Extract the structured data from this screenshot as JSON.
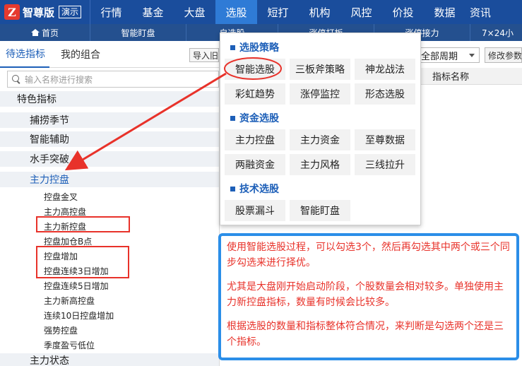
{
  "brand": {
    "logo_mark": "Z",
    "name": "智尊版",
    "demo": "演示"
  },
  "topnav": [
    "行情",
    "基金",
    "大盘",
    "选股",
    "短打",
    "机构",
    "风控",
    "价投",
    "数据",
    "资讯"
  ],
  "subnav": [
    "首页",
    "智能盯盘",
    "自选股",
    "涨停打板",
    "涨停接力",
    "7×24小"
  ],
  "tabs": {
    "pending": "待选指标",
    "mine": "我的组合",
    "import": "导入旧"
  },
  "search": {
    "placeholder": "输入名称进行搜索"
  },
  "categories": [
    {
      "label": "特色指标"
    },
    {
      "label": "捕捞季节"
    },
    {
      "label": "智能辅助"
    },
    {
      "label": "水手突破"
    },
    {
      "label": "主力控盘"
    },
    {
      "label": "主力状态"
    }
  ],
  "sub_items": [
    "控盘金叉",
    "主力高控盘",
    "主力新控盘",
    "控盘加仓B点",
    "控盘增加",
    "控盘连续3日增加",
    "控盘连续5日增加",
    "主力新高控盘",
    "连续10日控盘增加",
    "强势控盘",
    "季度盈亏低位"
  ],
  "right": {
    "period": "全部周期",
    "modify": "修改参数",
    "col_header": "指标名称"
  },
  "popup": {
    "sections": [
      {
        "title": "选股策略",
        "items": [
          "智能选股",
          "三板斧策略",
          "神龙战法",
          "彩虹趋势",
          "涨停监控",
          "形态选股"
        ]
      },
      {
        "title": "资金选股",
        "items": [
          "主力控盘",
          "主力资金",
          "至尊数据",
          "两融资金",
          "主力风格",
          "三线拉升"
        ]
      },
      {
        "title": "技术选股",
        "items": [
          "股票漏斗",
          "智能盯盘"
        ]
      }
    ]
  },
  "note": {
    "p1": "使用智能选股过程，可以勾选3个，然后再勾选其中两个或三个同步勾选来进行择优。",
    "p2": "尤其是大盘刚开始启动阶段，个股数量会相对较多。单独使用主力新控盘指标，数量有时候会比较多。",
    "p3": "根据选股的数量和指标整体符合情况，来判断是勾选两个还是三个指标。"
  },
  "colors": {
    "nav_bg": "#1a4d9c",
    "nav_active": "#2f7bd6",
    "accent_blue": "#1d5fb8",
    "annotation_red": "#e8322a",
    "note_border": "#2b8ee8"
  }
}
